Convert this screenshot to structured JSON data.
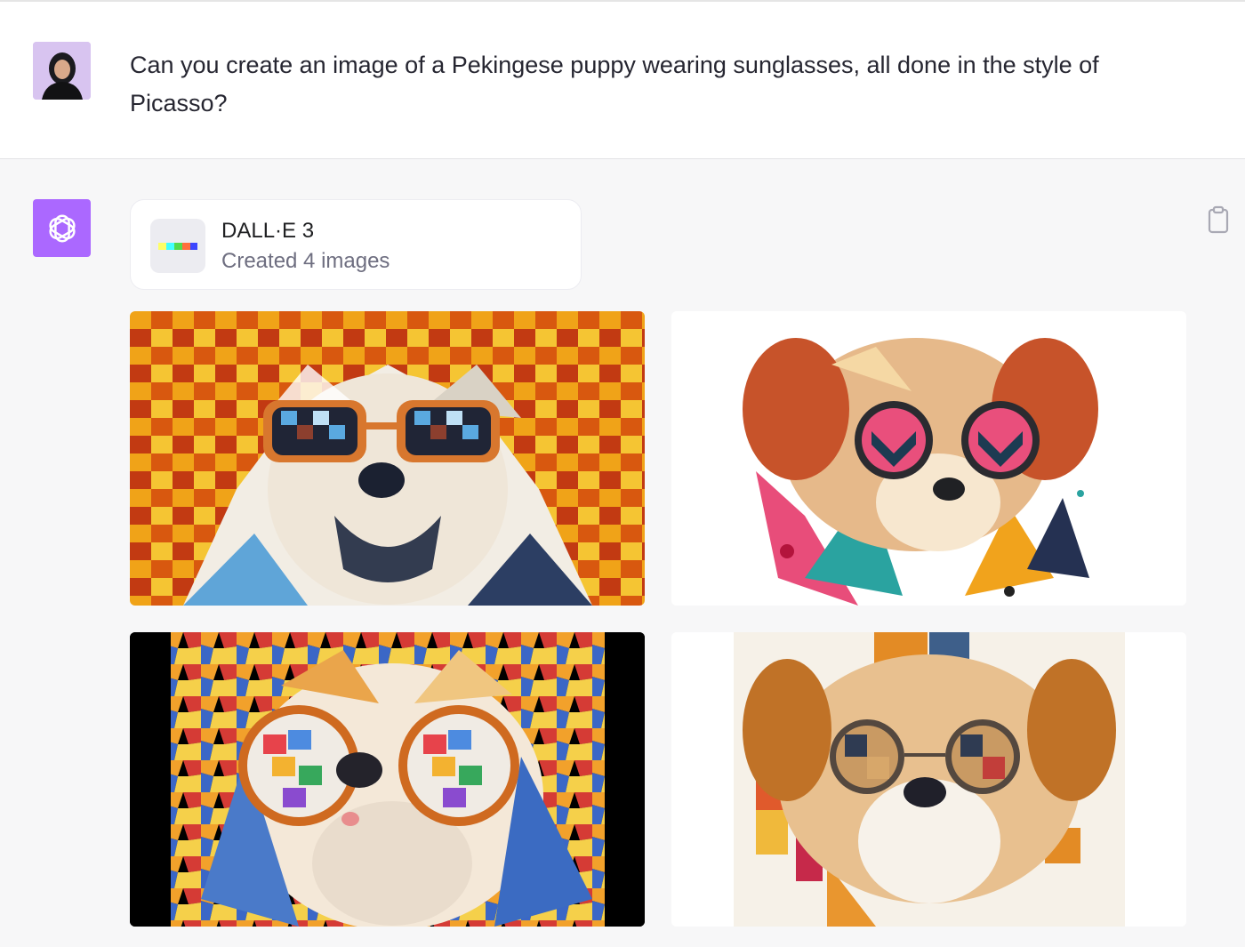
{
  "conversation": {
    "user_message": "Can you create an image of a Pekingese puppy wearing sunglasses, all done in the style of Picasso?",
    "assistant": {
      "tool_name": "DALL·E 3",
      "tool_status": "Created 4 images",
      "accent_color": "#ab68ff",
      "images": [
        {
          "name": "generated-image-1",
          "background": "#e9791a"
        },
        {
          "name": "generated-image-2",
          "background": "#ffffff"
        },
        {
          "name": "generated-image-3",
          "background": "#000000"
        },
        {
          "name": "generated-image-4",
          "background": "#ffffff"
        }
      ]
    }
  },
  "icons": {
    "user_avatar": "user-avatar-photo",
    "assistant_avatar": "openai-logo-icon",
    "tool_icon": "dalle-color-bar-icon",
    "copy": "clipboard-icon"
  }
}
